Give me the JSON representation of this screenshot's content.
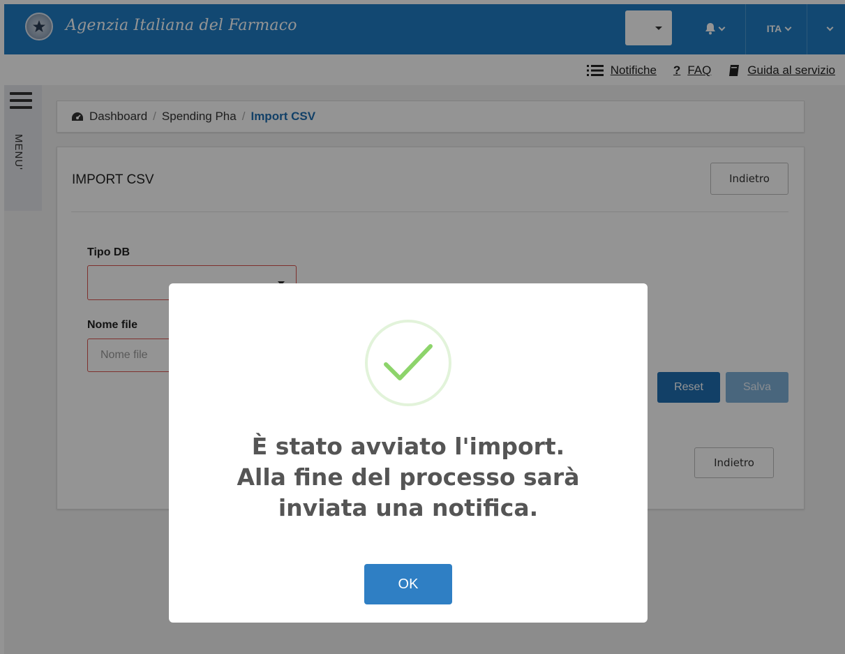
{
  "header": {
    "brand": "Agenzia Italiana del Farmaco",
    "lang": "ITA",
    "emblem_icon": "republic-emblem-icon",
    "bell_icon": "bell-icon"
  },
  "links": {
    "notifiche": "Notifiche",
    "faq_mark": "?",
    "faq": "FAQ",
    "guida": "Guida al servizio"
  },
  "sidebar": {
    "menu_label": "MENU'"
  },
  "breadcrumb": {
    "items": [
      "Dashboard",
      "Spending Pha",
      "Import CSV"
    ],
    "separator": "/"
  },
  "panel": {
    "title": "IMPORT CSV",
    "back_top": "Indietro",
    "tipo_db_label": "Tipo DB",
    "nome_file_label": "Nome file",
    "nome_file_placeholder": "Nome file",
    "reset": "Reset",
    "salva": "Salva",
    "back_bottom": "Indietro"
  },
  "modal": {
    "lines": [
      "È stato avviato l'import.",
      "Alla fine del processo sarà",
      "inviata una notifica."
    ],
    "ok": "OK",
    "icon": "success-check-icon"
  },
  "colors": {
    "brand_blue": "#1f7dc4",
    "primary": "#1f6fb2",
    "error_border": "#d9534f",
    "success_green": "#8dd46b"
  }
}
